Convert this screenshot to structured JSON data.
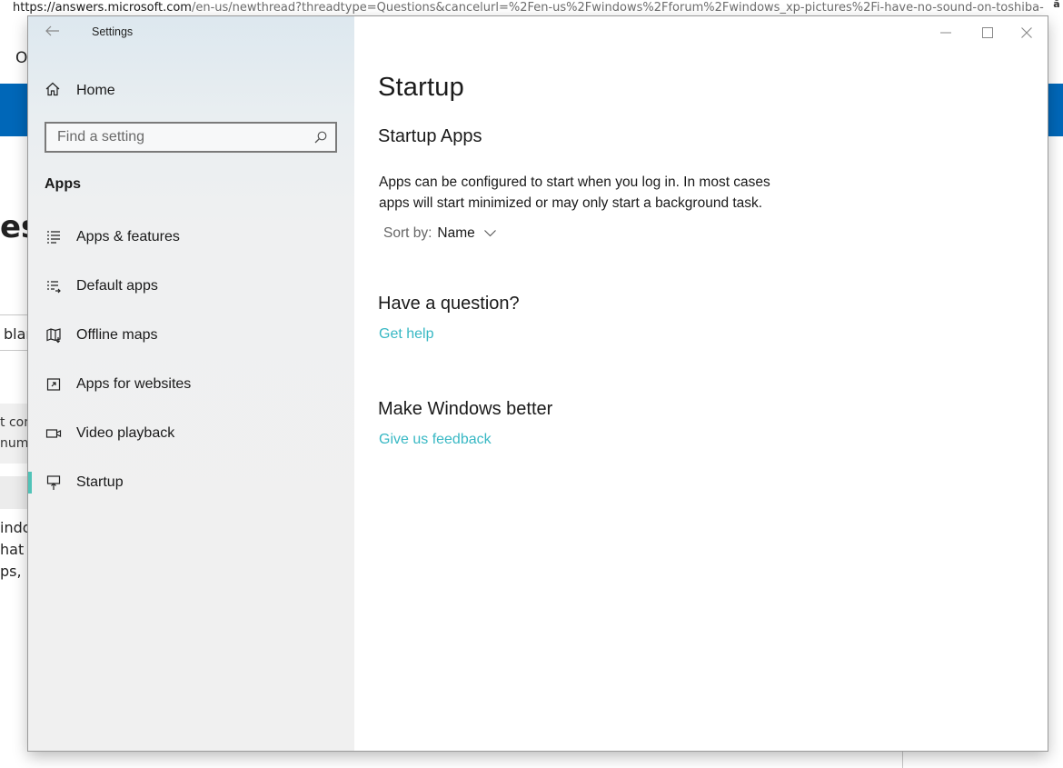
{
  "background_page": {
    "url_domain": "https://answers.microsoft.com",
    "url_rest": "/en-us/newthread?threadtype=Questions&cancelurl=%2Fen-us%2Fwindows%2Fforum%2Fwindows_xp-pictures%2Fi-have-no-sound-on-toshiba-",
    "corner_text": "ã",
    "fragments": [
      "O",
      "es",
      "blar",
      "t com",
      "numb",
      "indo",
      "hat",
      "ps, i"
    ],
    "accent_color": "#0067b8"
  },
  "window": {
    "title": "Settings",
    "back_icon": "back-arrow-icon",
    "controls": [
      "minimize-icon",
      "maximize-icon",
      "close-icon"
    ]
  },
  "sidebar": {
    "home_label": "Home",
    "search_placeholder": "Find a setting",
    "section_heading": "Apps",
    "items": [
      {
        "label": "Apps & features",
        "icon": "apps-features-icon"
      },
      {
        "label": "Default apps",
        "icon": "default-apps-icon"
      },
      {
        "label": "Offline maps",
        "icon": "offline-maps-icon"
      },
      {
        "label": "Apps for websites",
        "icon": "apps-for-websites-icon"
      },
      {
        "label": "Video playback",
        "icon": "video-playback-icon"
      },
      {
        "label": "Startup",
        "icon": "startup-icon",
        "selected": true
      }
    ],
    "selection_color": "#51c3b8"
  },
  "main": {
    "page_title": "Startup",
    "section_title": "Startup Apps",
    "description_line1": "Apps can be configured to start when you log in. In most cases",
    "description_line2": "apps will start minimized or may only start a background task.",
    "sort_label": "Sort by:",
    "sort_value": "Name",
    "question_heading": "Have a question?",
    "help_link": "Get help",
    "feedback_heading": "Make Windows better",
    "feedback_link": "Give us feedback",
    "link_color": "#38b8c4"
  }
}
